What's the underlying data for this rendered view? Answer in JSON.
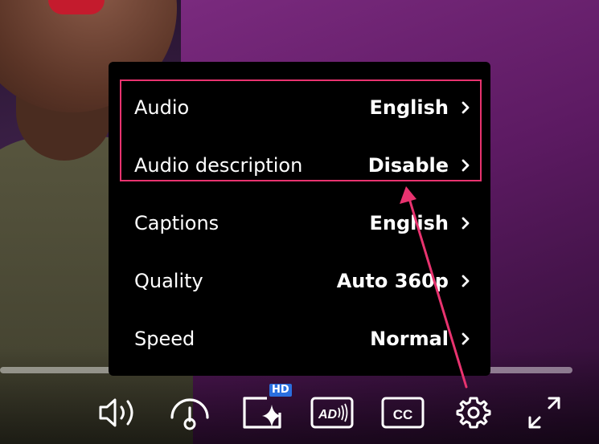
{
  "settings_menu": {
    "items": [
      {
        "label": "Audio",
        "value": "English"
      },
      {
        "label": "Audio description",
        "value": "Disable"
      },
      {
        "label": "Captions",
        "value": "English"
      },
      {
        "label": "Quality",
        "value": "Auto 360p"
      },
      {
        "label": "Speed",
        "value": "Normal"
      }
    ]
  },
  "annotation": {
    "highlight_color": "#e8336f"
  },
  "player": {
    "hd_badge": "HD",
    "controls": [
      {
        "icon": "volume-icon"
      },
      {
        "icon": "speedometer-icon"
      },
      {
        "icon": "quality-sparkle-icon"
      },
      {
        "icon": "audio-description-icon",
        "text": "AD"
      },
      {
        "icon": "closed-captions-icon",
        "text": "CC"
      },
      {
        "icon": "gear-icon"
      },
      {
        "icon": "fullscreen-icon"
      }
    ]
  }
}
